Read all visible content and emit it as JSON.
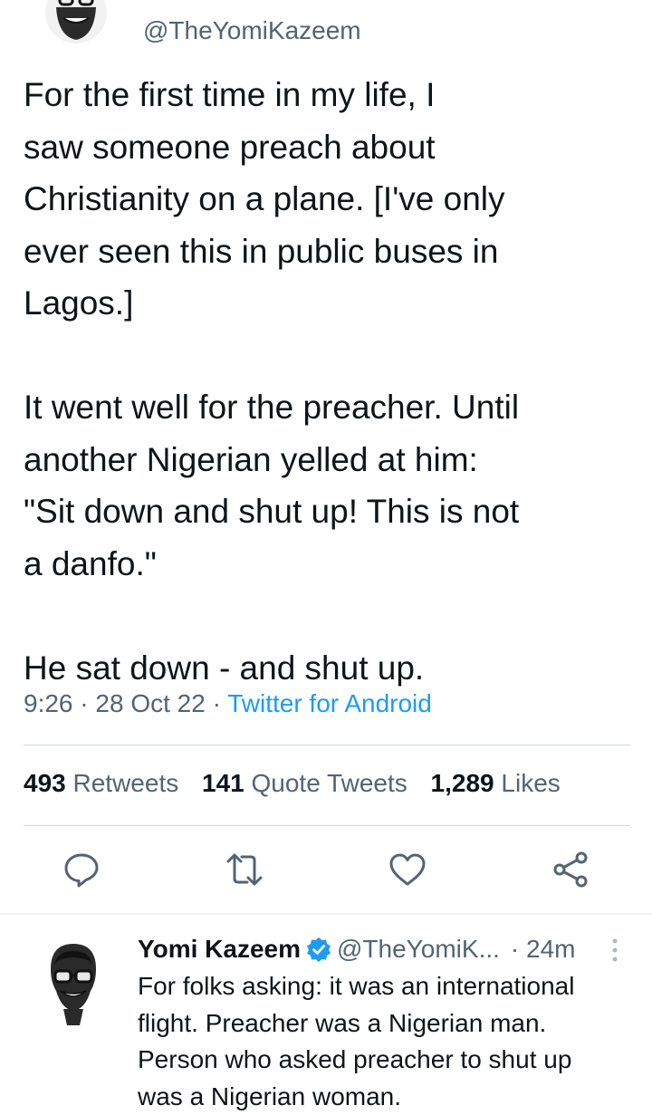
{
  "tweet": {
    "handle": "@TheYomiKazeem",
    "text": "For the first time in my life, I\nsaw someone preach about\nChristianity on a plane. [I've only\never seen this in public buses in\nLagos.]\n\nIt went well for the preacher. Until\nanother Nigerian yelled at him:\n\"Sit down and shut up! This is not\na danfo.\"\n\nHe sat down - and shut up.",
    "time": "9:26",
    "date": "28 Oct 22",
    "source": "Twitter for Android",
    "sep": " · "
  },
  "stats": {
    "retweets_count": "493",
    "retweets_label": "Retweets",
    "quotes_count": "141",
    "quotes_label": "Quote Tweets",
    "likes_count": "1,289",
    "likes_label": "Likes"
  },
  "actions": {
    "icons": [
      "reply-icon",
      "retweet-icon",
      "like-icon",
      "share-icon"
    ]
  },
  "reply": {
    "name": "Yomi Kazeem",
    "handle": "@TheYomiK...",
    "time": "· 24m",
    "text": "For folks asking: it was an international\nflight. Preacher was a Nigerian man.\nPerson who asked preacher to shut up\nwas a Nigerian woman."
  },
  "colors": {
    "accent": "#1d9bf0",
    "secondary_text": "#536471",
    "primary_text": "#0f1419",
    "divider": "#cfd9de"
  }
}
